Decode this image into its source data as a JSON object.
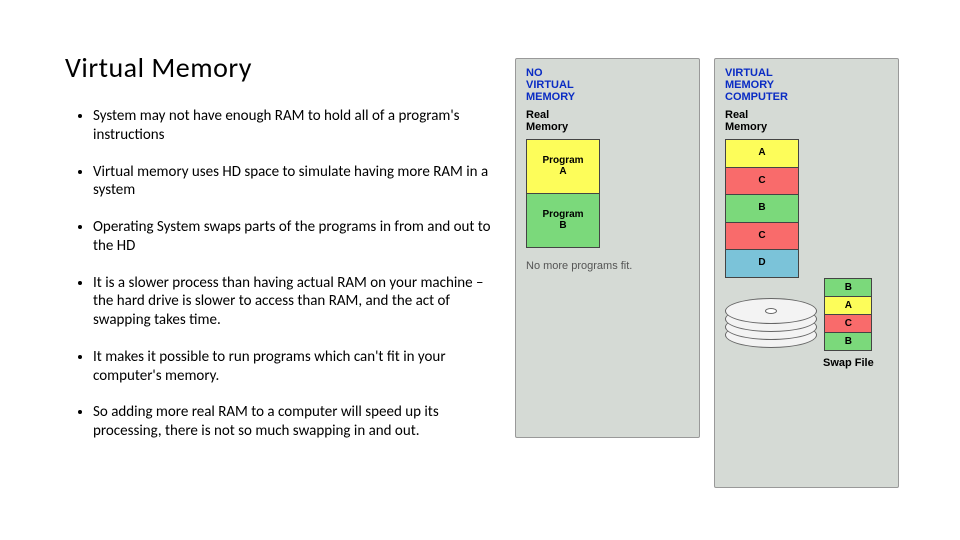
{
  "title": "Virtual Memory",
  "bullets": [
    "System may not have enough RAM to hold all of a program's instructions",
    "Virtual memory uses HD space to simulate having more RAM in a system",
    "Operating System swaps parts of the programs in from and out to the HD",
    "It is a slower process than having actual RAM on your machine – the hard drive is slower to access than RAM, and the act of swapping takes time.",
    "It makes it possible to run programs which can't fit in your computer's memory.",
    "So adding more real RAM to a computer will speed up its processing, there is not so much swapping in and out."
  ],
  "diagram": {
    "left_panel": {
      "header": "NO\nVIRTUAL\nMEMORY",
      "subheader": "Real\nMemory",
      "blocks": [
        {
          "label": "Program\nA",
          "color": "c-y",
          "tall": true
        },
        {
          "label": "Program\nB",
          "color": "c-g",
          "tall": true
        }
      ],
      "caption": "No more programs fit."
    },
    "right_panel": {
      "header": "VIRTUAL\nMEMORY\nCOMPUTER",
      "subheader": "Real\nMemory",
      "blocks": [
        {
          "label": "A",
          "color": "c-y"
        },
        {
          "label": "C",
          "color": "c-r"
        },
        {
          "label": "B",
          "color": "c-g"
        },
        {
          "label": "C",
          "color": "c-r"
        },
        {
          "label": "D",
          "color": "c-b"
        }
      ],
      "swap_blocks": [
        {
          "label": "B",
          "color": "c-g"
        },
        {
          "label": "A",
          "color": "c-y"
        },
        {
          "label": "C",
          "color": "c-r"
        },
        {
          "label": "B",
          "color": "c-g"
        }
      ],
      "swap_label": "Swap File"
    }
  }
}
